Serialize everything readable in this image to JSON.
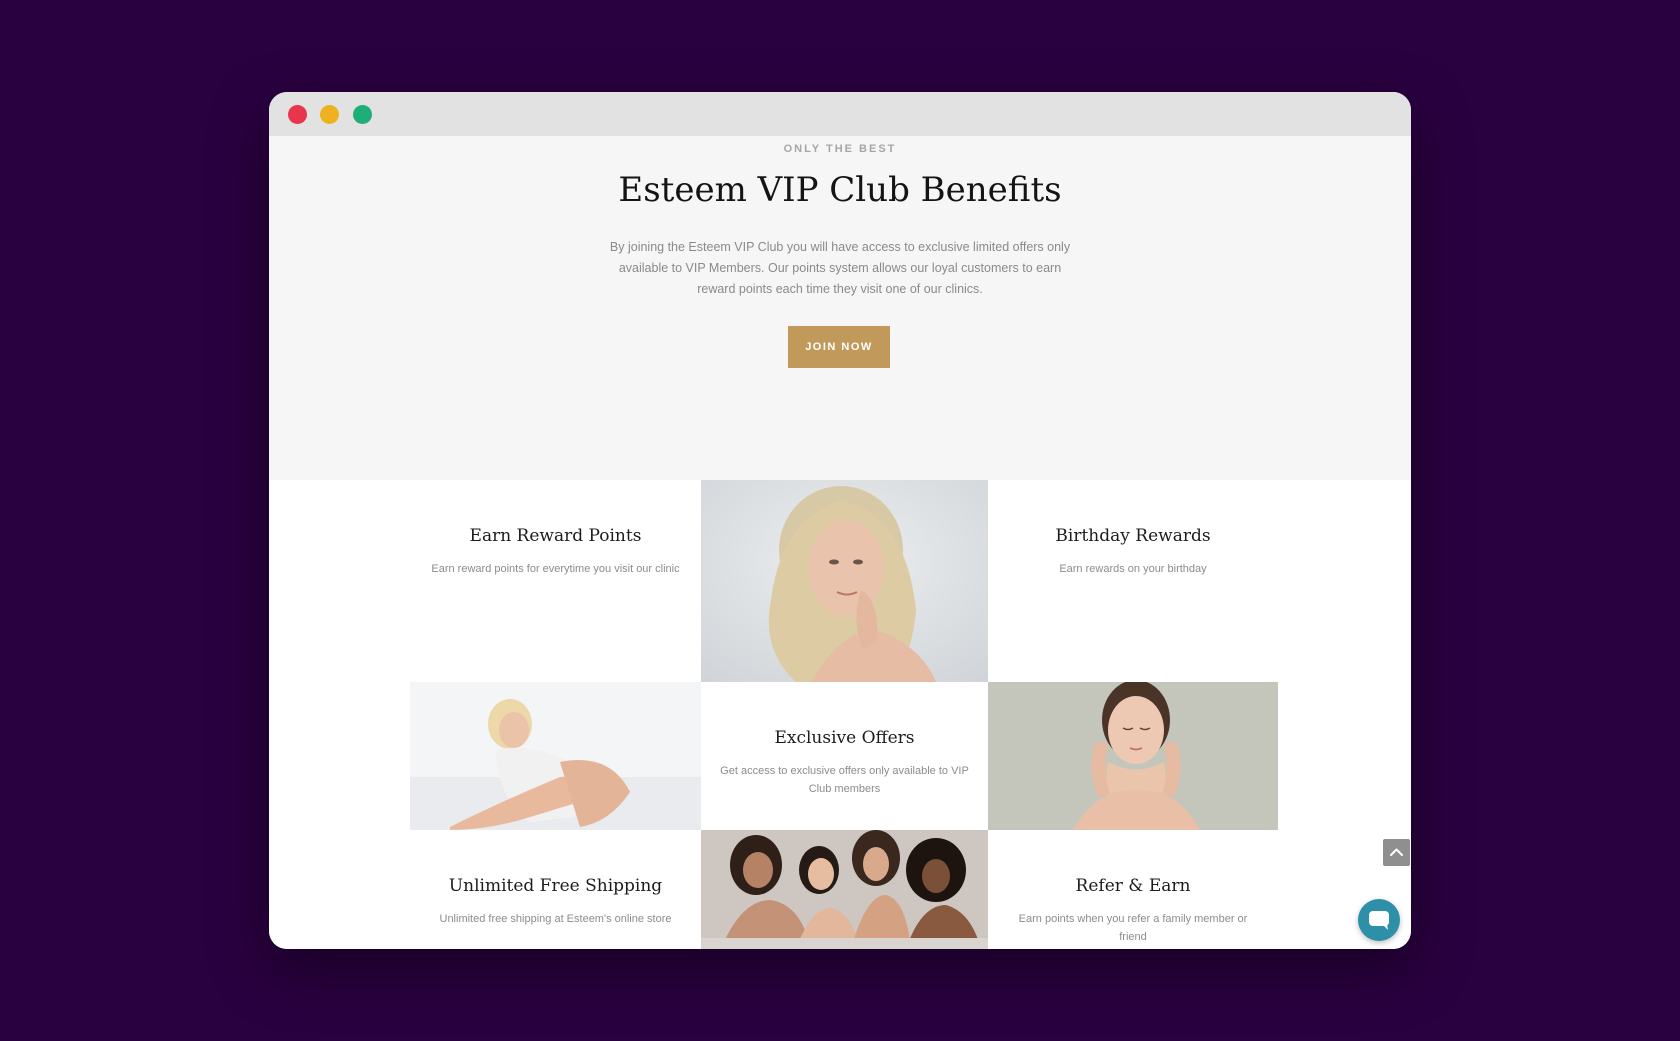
{
  "hero": {
    "eyebrow": "ONLY THE BEST",
    "title": "Esteem VIP Club Benefits",
    "description": "By joining the Esteem VIP Club you will have access to exclusive limited offers only available to VIP Members. Our points system allows our loyal customers to earn reward points each time they visit one of our clinics.",
    "join_button": "JOIN NOW"
  },
  "benefits": [
    {
      "title": "Earn Reward Points",
      "text": "Earn reward points for everytime you visit our clinic"
    },
    {
      "title": "Birthday Rewards",
      "text": "Earn rewards on your birthday"
    },
    {
      "title": "Exclusive Offers",
      "text": "Get access to exclusive offers only available to VIP Club members"
    },
    {
      "title": "Unlimited Free Shipping",
      "text": "Unlimited free shipping at Esteem's online store"
    },
    {
      "title": "Refer & Earn",
      "text": "Earn points when you refer a family member or friend"
    }
  ],
  "icons": {
    "scroll_top": "chevron-up-icon",
    "chat": "chat-bubble-icon"
  },
  "colors": {
    "background": "#2a0140",
    "accent_gold": "#c19a5b",
    "chat_button": "#2d8fa8"
  }
}
